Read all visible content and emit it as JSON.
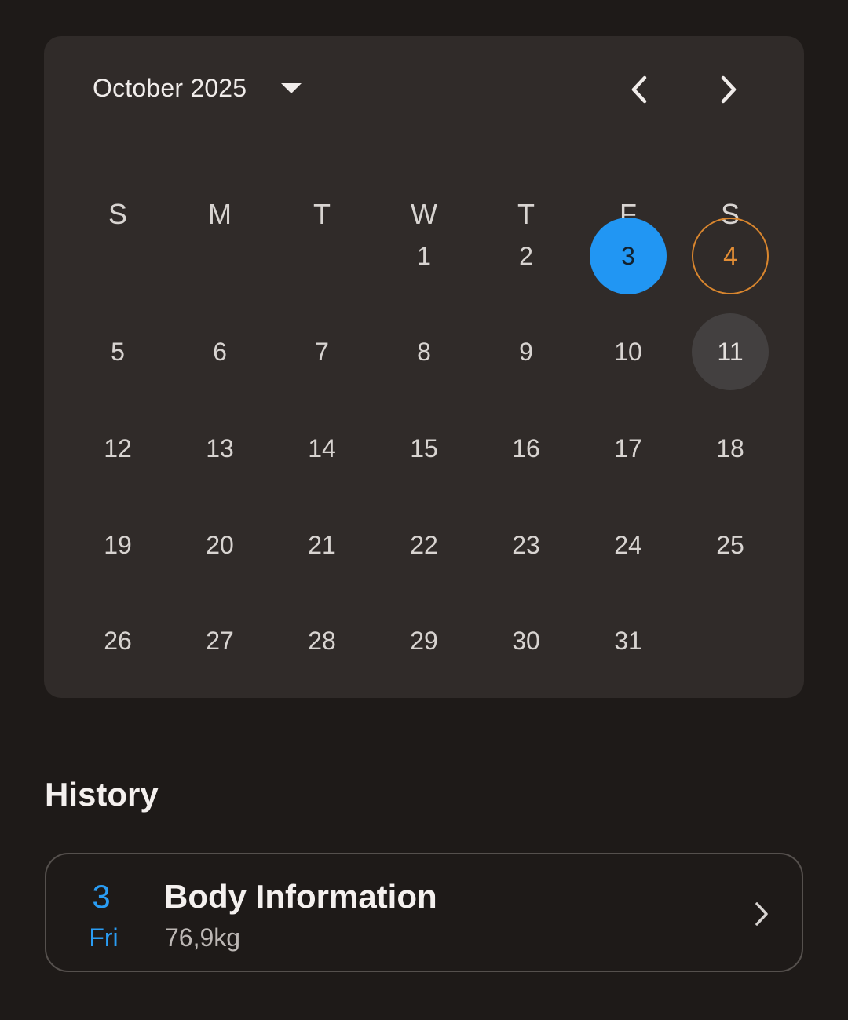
{
  "calendar": {
    "month_label": "October 2025",
    "icons": {
      "dropdown": "caret-down-icon",
      "prev": "chevron-left-icon",
      "next": "chevron-right-icon"
    },
    "weekdays": [
      "S",
      "M",
      "T",
      "W",
      "T",
      "F",
      "S"
    ],
    "leading_blank_days": 3,
    "days": [
      "1",
      "2",
      "3",
      "4",
      "5",
      "6",
      "7",
      "8",
      "9",
      "10",
      "11",
      "12",
      "13",
      "14",
      "15",
      "16",
      "17",
      "18",
      "19",
      "20",
      "21",
      "22",
      "23",
      "24",
      "25",
      "26",
      "27",
      "28",
      "29",
      "30",
      "31"
    ],
    "selected_day": "3",
    "today_day": "4",
    "highlighted_day": "11",
    "colors": {
      "selected": "#2196f3",
      "today_ring": "#d9862e",
      "highlighted": "#434040"
    }
  },
  "history": {
    "title": "History",
    "items": [
      {
        "day_number": "3",
        "day_name": "Fri",
        "title": "Body Information",
        "value": "76,9kg",
        "accent": "#2a9df4"
      }
    ]
  }
}
